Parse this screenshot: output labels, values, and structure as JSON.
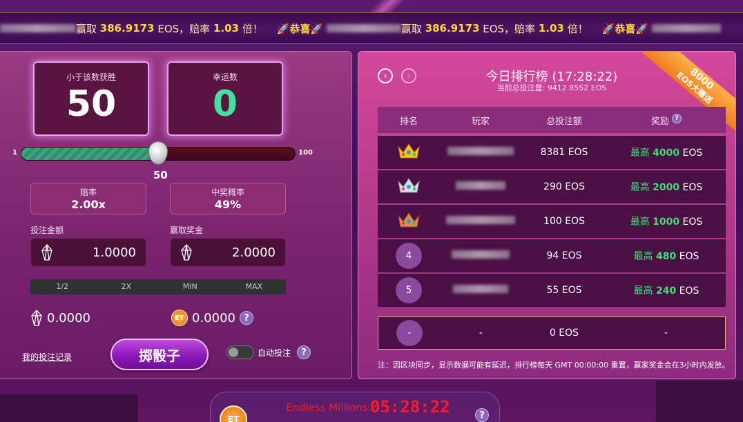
{
  "ticker": {
    "items": [
      {
        "prefix": "",
        "win_label": "赢取",
        "amount": "386.9173",
        "unit": "EOS，赔率",
        "odds": "1.03",
        "suffix": "倍！"
      },
      {
        "prefix": "🚀恭喜🚀",
        "win_label": "赢取",
        "amount": "386.9173",
        "unit": "EOS，赔率",
        "odds": "1.03",
        "suffix": "倍！"
      },
      {
        "prefix": "🚀恭喜🚀",
        "win_label": "",
        "amount": "",
        "unit": "",
        "odds": "",
        "suffix": ""
      }
    ]
  },
  "game": {
    "under_label": "小于该数获胜",
    "under_value": "50",
    "lucky_label": "幸运数",
    "lucky_value": "0",
    "slider": {
      "min": "1",
      "max": "100",
      "value": "50",
      "fraction": 0.5
    },
    "odds_label": "赔率",
    "odds_value": "2.00x",
    "win_rate_label": "中奖概率",
    "win_rate_value": "49%",
    "bet_amount_label": "投注金额",
    "bet_amount_value": "1.0000",
    "payout_label": "赢取奖金",
    "payout_value": "2.0000",
    "quick": [
      "1/2",
      "2X",
      "MIN",
      "MAX"
    ],
    "eos_balance": "0.0000",
    "et_balance": "0.0000",
    "et_icon_text": "ET",
    "my_bets_link": "我的投注记录",
    "roll_button": "掷骰子",
    "auto_bet_label": "自动投注",
    "help_glyph": "?"
  },
  "leaderboard": {
    "title": "今日排行榜 (17:28:22)",
    "subtitle": "当前总投注量: 9412.8552 EOS",
    "nav_prev": "‹",
    "nav_next": "›",
    "ribbon_line1": "8000",
    "ribbon_line2": "EOS大赠送",
    "headers": {
      "rank": "排名",
      "player": "玩家",
      "bet": "总投注额",
      "reward": "奖励"
    },
    "rows": [
      {
        "rank": "",
        "crown": "gold",
        "bet": "8381 EOS",
        "reward_pre": "最高 ",
        "reward_amt": "4000",
        "reward_unit": " EOS"
      },
      {
        "rank": "",
        "crown": "silver",
        "bet": "290 EOS",
        "reward_pre": "最高 ",
        "reward_amt": "2000",
        "reward_unit": " EOS"
      },
      {
        "rank": "",
        "crown": "bronze",
        "bet": "100 EOS",
        "reward_pre": "最高 ",
        "reward_amt": "1000",
        "reward_unit": " EOS"
      },
      {
        "rank": "4",
        "crown": "",
        "bet": "94 EOS",
        "reward_pre": "最高 ",
        "reward_amt": "480",
        "reward_unit": " EOS"
      },
      {
        "rank": "5",
        "crown": "",
        "bet": "55 EOS",
        "reward_pre": "最高 ",
        "reward_amt": "240",
        "reward_unit": " EOS"
      }
    ],
    "my_row": {
      "rank": "-",
      "player": "-",
      "bet": "0 EOS",
      "reward": "-"
    },
    "footnote": "注：因区块同步，显示数据可能有延迟，排行榜每天 GMT 00:00:00 重置，赢家奖金会在3小时内发放。"
  },
  "bottom": {
    "et_label": "ET",
    "endless_label": "Endless Millions:",
    "countdown": "05:28:22"
  },
  "colors": {
    "green": "#3de06e",
    "gold": "#ffd93b",
    "red": "#ff1a24"
  }
}
